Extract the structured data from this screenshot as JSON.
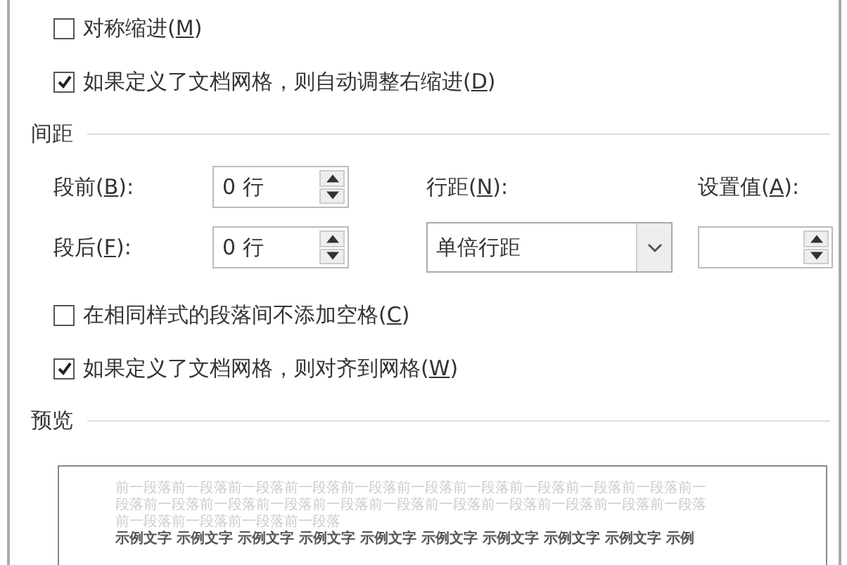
{
  "indent_options": [
    {
      "label": "对称缩进(M)",
      "checked": false
    },
    {
      "label": "如果定义了文档网格，则自动调整右缩进(D)",
      "checked": true
    }
  ],
  "spacing": {
    "title": "间距",
    "before": {
      "label": "段前(B):",
      "value": "0 行"
    },
    "after": {
      "label": "段后(F):",
      "value": "0 行"
    },
    "line_spacing": {
      "label": "行距(N):",
      "value": "单倍行距"
    },
    "set_value": {
      "label": "设置值(A):"
    }
  },
  "spacing_options": [
    {
      "label": "在相同样式的段落间不添加空格(C)",
      "checked": false
    },
    {
      "label": "如果定义了文档网格，则对齐到网格(W)",
      "checked": true
    }
  ],
  "preview": {
    "title": "预览",
    "previous_paragraph_lines": [
      "前一段落前一段落前一段落前一段落前一段落前一段落前一段落前一段落前一段落前一段落前一",
      "段落前一段落前一段落前一段落前一段落前一段落前一段落前一段落前一段落前一段落前一段落",
      "前一段落前一段落前一段落前一段落"
    ],
    "sample_text": [
      "示例文字 示例文字 示例文字 示例文字 示例文字 示例文字 示例文字 示例文字 示例文字 示例"
    ]
  }
}
